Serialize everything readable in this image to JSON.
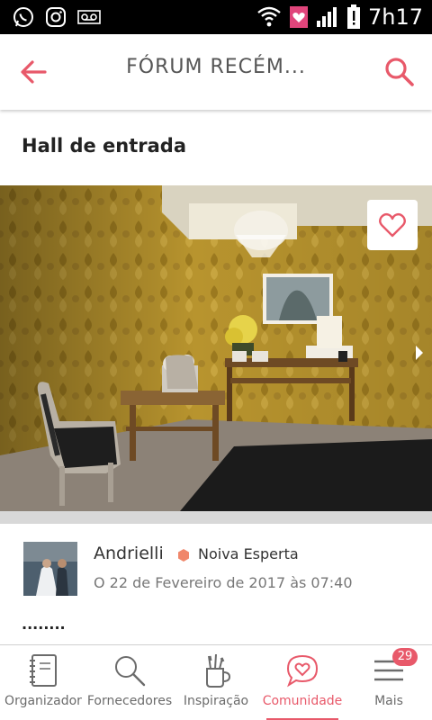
{
  "status_bar": {
    "time": "7h17",
    "icons": [
      "whatsapp-icon",
      "instagram-icon",
      "voicemail-icon",
      "wifi-icon",
      "app-notification-icon",
      "signal-icon",
      "battery-alert-icon"
    ]
  },
  "app_bar": {
    "title": "FÓRUM RECÉM...",
    "back_icon": "back-arrow-icon",
    "search_icon": "search-icon"
  },
  "page": {
    "title": "Hall de entrada"
  },
  "photo": {
    "favorite_icon": "heart-outline-icon",
    "next_icon": "chevron-right-icon"
  },
  "post": {
    "author": "Andrielli",
    "badge_label": "Noiva Esperta",
    "date": "O 22 de Fevereiro de 2017 às 07:40",
    "body": "........"
  },
  "bottom_nav": {
    "items": [
      {
        "label": "Organizador",
        "icon": "notebook-icon",
        "active": false
      },
      {
        "label": "Fornecedores",
        "icon": "search-icon",
        "active": false
      },
      {
        "label": "Inspiração",
        "icon": "brushes-icon",
        "active": false
      },
      {
        "label": "Comunidade",
        "icon": "chat-heart-icon",
        "active": true
      },
      {
        "label": "Mais",
        "icon": "menu-icon",
        "active": false
      }
    ],
    "more_badge": "29"
  },
  "colors": {
    "accent": "#e8596a",
    "text": "#222222",
    "muted": "#777777"
  }
}
